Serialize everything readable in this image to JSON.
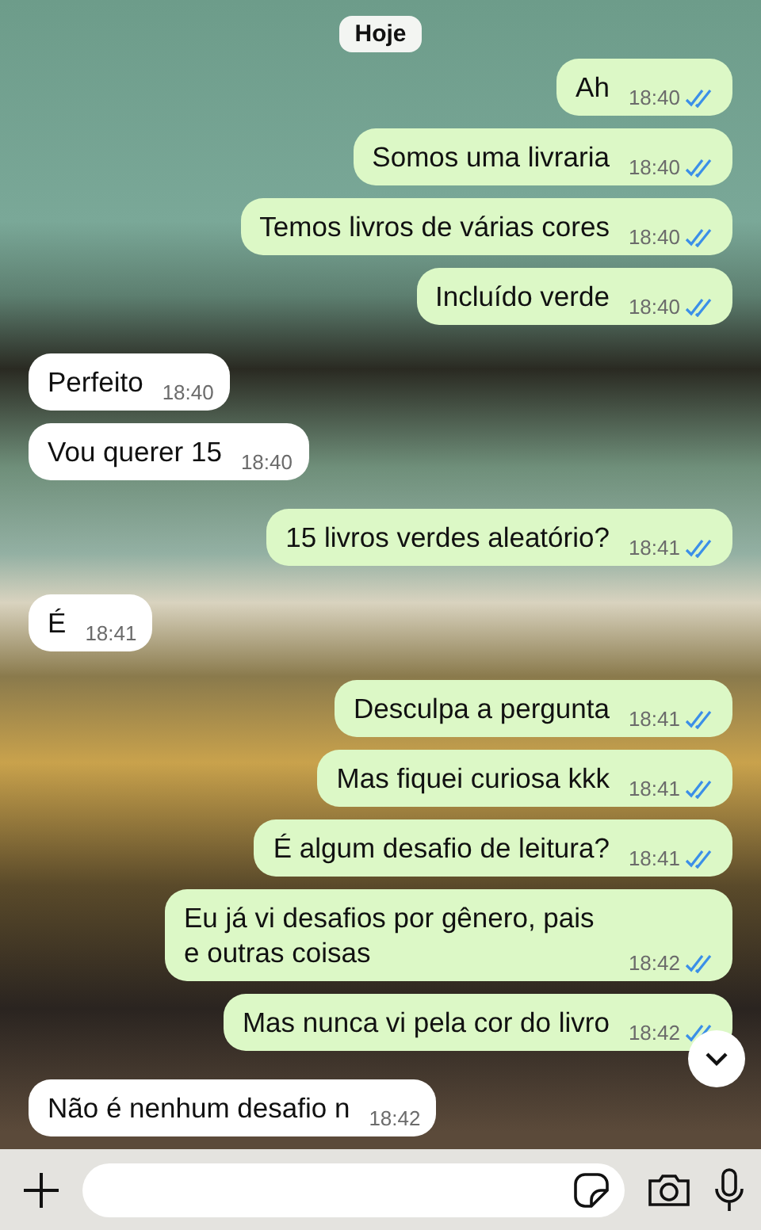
{
  "date_chip": "Hoje",
  "messages": [
    {
      "kind": "out",
      "text": "Ah",
      "time": "18:40",
      "read": true
    },
    {
      "kind": "out",
      "text": "Somos uma livraria",
      "time": "18:40",
      "read": true
    },
    {
      "kind": "out",
      "text": "Temos livros de várias cores",
      "time": "18:40",
      "read": true
    },
    {
      "kind": "out",
      "text": "Incluído verde",
      "time": "18:40",
      "read": true
    },
    {
      "kind": "in",
      "text": "Perfeito",
      "time": "18:40"
    },
    {
      "kind": "in",
      "text": "Vou querer 15",
      "time": "18:40"
    },
    {
      "kind": "out",
      "text": "15 livros verdes aleatório?",
      "time": "18:41",
      "read": true
    },
    {
      "kind": "in",
      "text": "É",
      "time": "18:41"
    },
    {
      "kind": "out",
      "text": "Desculpa a pergunta",
      "time": "18:41",
      "read": true
    },
    {
      "kind": "out",
      "text": "Mas fiquei curiosa kkk",
      "time": "18:41",
      "read": true
    },
    {
      "kind": "out",
      "text": "É algum desafio de leitura?",
      "time": "18:41",
      "read": true
    },
    {
      "kind": "out",
      "text": "Eu já vi desafios por gênero, pais e outras coisas",
      "time": "18:42",
      "read": true
    },
    {
      "kind": "out",
      "text": "Mas nunca vi pela cor do livro",
      "time": "18:42",
      "read": true
    },
    {
      "kind": "in",
      "text": "Não é nenhum desafio n",
      "time": "18:42"
    }
  ]
}
